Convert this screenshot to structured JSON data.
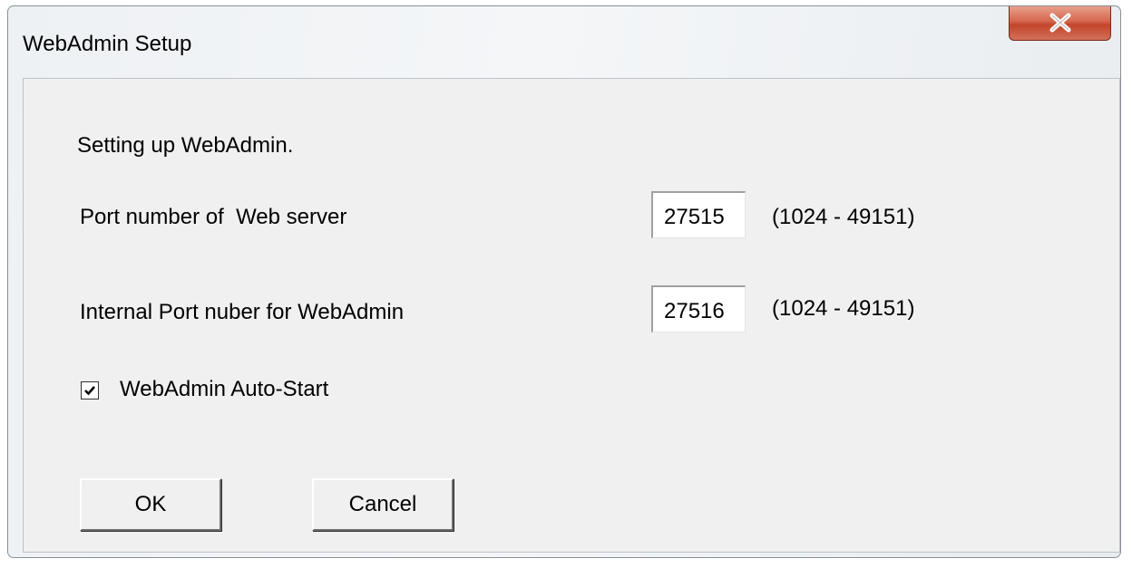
{
  "window": {
    "title": "WebAdmin Setup"
  },
  "dialog": {
    "intro_text": "Setting up WebAdmin.",
    "web_port": {
      "label": "Port number of  Web server",
      "value": "27515",
      "range": "(1024 - 49151)"
    },
    "internal_port": {
      "label": "Internal Port nuber for WebAdmin",
      "value": "27516",
      "range": "(1024 - 49151)"
    },
    "autostart": {
      "label": "WebAdmin Auto-Start",
      "checked": true
    },
    "buttons": {
      "ok_label": "OK",
      "cancel_label": "Cancel"
    }
  },
  "icons": {
    "close": "close-icon",
    "check": "checkmark-icon"
  },
  "colors": {
    "close_button": "#c94a30",
    "dialog_background": "#f0f0f0"
  }
}
